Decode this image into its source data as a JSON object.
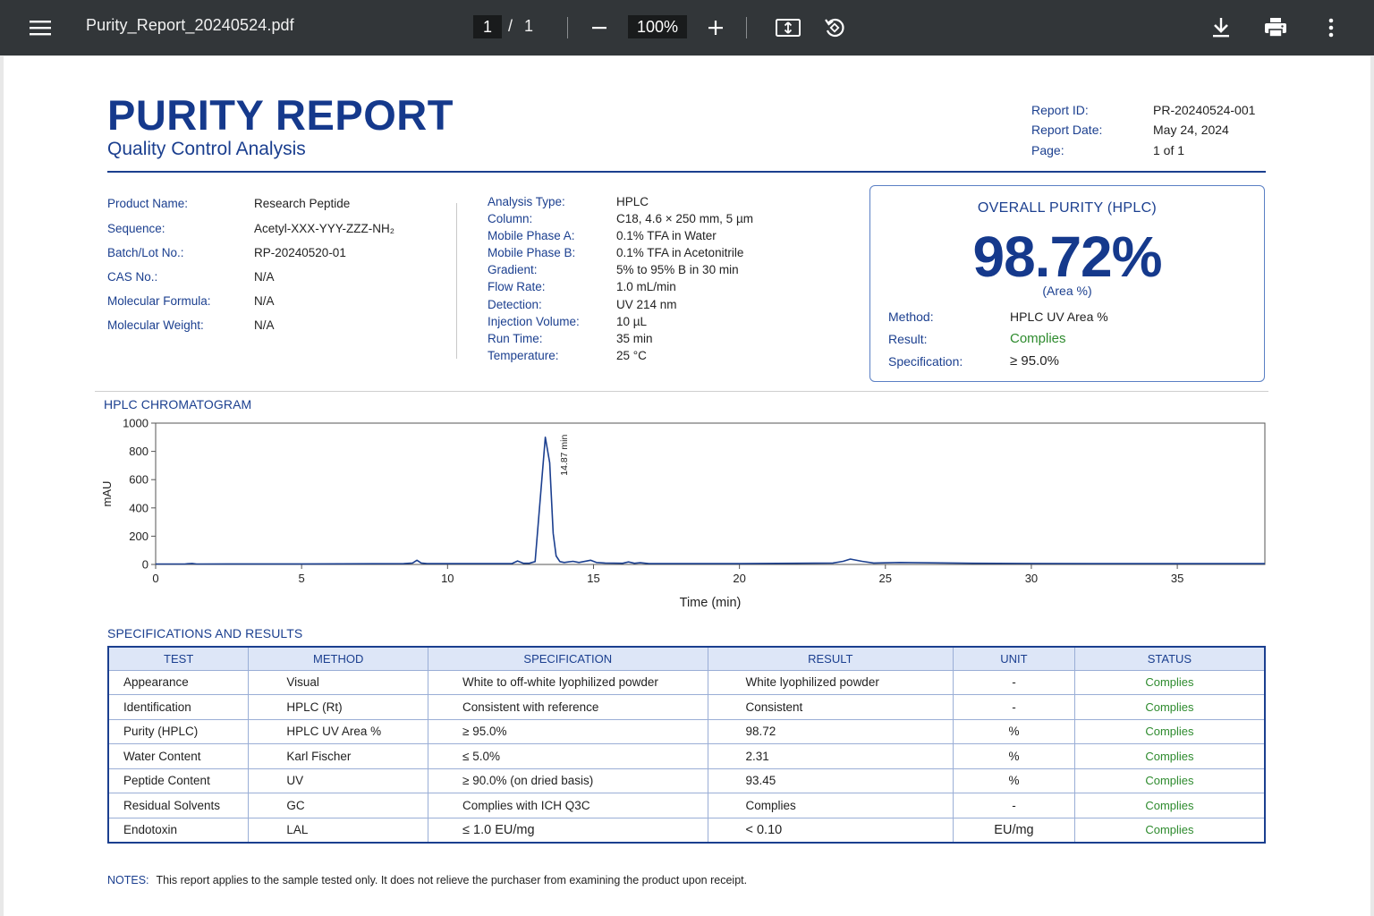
{
  "viewer": {
    "file_name": "Purity_Report_20240524.pdf",
    "current_page": "1",
    "page_separator": "/",
    "total_pages": "1",
    "zoom": "100%",
    "icons": [
      "menu-icon",
      "zoom-out-icon",
      "zoom-in-icon",
      "fit-page-icon",
      "rotate-icon",
      "download-icon",
      "print-icon",
      "more-icon"
    ]
  },
  "report": {
    "title": "PURITY REPORT",
    "subtitle": "Quality Control Analysis",
    "meta": [
      {
        "label": "Report ID:",
        "value": "PR-20240524-001"
      },
      {
        "label": "Report Date:",
        "value": "May 24, 2024"
      },
      {
        "label": "Page:",
        "value": "1 of 1"
      }
    ],
    "product": [
      {
        "label": "Product Name:",
        "value": "Research Peptide"
      },
      {
        "label": "Sequence:",
        "value": "Acetyl-XXX-YYY-ZZZ-NH₂"
      },
      {
        "label": "Batch/Lot No.:",
        "value": "RP-20240520-01"
      },
      {
        "label": "CAS No.:",
        "value": "N/A"
      },
      {
        "label": "Molecular Formula:",
        "value": "N/A"
      },
      {
        "label": "Molecular Weight:",
        "value": "N/A"
      }
    ],
    "analysis": [
      {
        "label": "Analysis Type:",
        "value": "HPLC"
      },
      {
        "label": "Column:",
        "value": "C18, 4.6 × 250 mm, 5 µm"
      },
      {
        "label": "Mobile Phase A:",
        "value": "0.1% TFA in Water"
      },
      {
        "label": "Mobile Phase B:",
        "value": "0.1% TFA in Acetonitrile"
      },
      {
        "label": "Gradient:",
        "value": "5% to 95% B in 30 min"
      },
      {
        "label": "Flow Rate:",
        "value": "1.0 mL/min"
      },
      {
        "label": "Detection:",
        "value": "UV 214 nm"
      },
      {
        "label": "Injection Volume:",
        "value": "10 µL"
      },
      {
        "label": "Run Time:",
        "value": "35 min"
      },
      {
        "label": "Temperature:",
        "value": "25 °C"
      }
    ],
    "purity": {
      "heading": "OVERALL PURITY (HPLC)",
      "value": "98.72%",
      "basis": "(Area %)",
      "rows": [
        {
          "label": "Method:",
          "value": "HPLC UV Area %"
        },
        {
          "label": "Result:",
          "value": "Complies"
        },
        {
          "label": "Specification:",
          "value": "≥ 95.0%"
        }
      ]
    },
    "chromatogram_title": "HPLC CHROMATOGRAM",
    "specs_title": "SPECIFICATIONS AND RESULTS",
    "specs_headers": [
      "TEST",
      "METHOD",
      "SPECIFICATION",
      "RESULT",
      "UNIT",
      "STATUS"
    ],
    "specs_rows": [
      [
        "Appearance",
        "Visual",
        "White to off-white lyophilized powder",
        "White lyophilized powder",
        "-",
        "Complies"
      ],
      [
        "Identification",
        "HPLC (Rt)",
        "Consistent with reference",
        "Consistent",
        "-",
        "Complies"
      ],
      [
        "Purity (HPLC)",
        "HPLC UV Area %",
        "≥ 95.0%",
        "98.72",
        "%",
        "Complies"
      ],
      [
        "Water Content",
        "Karl Fischer",
        "≤ 5.0%",
        "2.31",
        "%",
        "Complies"
      ],
      [
        "Peptide Content",
        "UV",
        "≥ 90.0% (on dried basis)",
        "93.45",
        "%",
        "Complies"
      ],
      [
        "Residual Solvents",
        "GC",
        "Complies with ICH Q3C",
        "Complies",
        "-",
        "Complies"
      ],
      [
        "Endotoxin",
        "LAL",
        "≤ 1.0 EU/mg",
        "< 0.10",
        "EU/mg",
        "Complies"
      ]
    ],
    "notes_label": "NOTES:",
    "notes_text": "This report applies to the sample tested only. It does not relieve the purchaser from examining the product upon receipt."
  },
  "chart_data": {
    "type": "line",
    "title": "",
    "xlabel": "Time (min)",
    "ylabel": "mAU",
    "xlim": [
      0,
      38
    ],
    "ylim": [
      0,
      1000
    ],
    "x_ticks": [
      0,
      5,
      10,
      15,
      20,
      25,
      30,
      35
    ],
    "x_tick_labels": [
      "0",
      "5",
      "10",
      "15",
      "20",
      "25",
      "30",
      "35"
    ],
    "y_ticks": [
      0,
      200,
      400,
      600,
      800,
      1000
    ],
    "y_tick_labels": [
      "0",
      "200",
      "400",
      "600",
      "800",
      "1000"
    ],
    "grid": false,
    "color": "#1b3f8f",
    "annotations": [
      {
        "x": 14.1,
        "y": 920,
        "text": "14.87 min"
      }
    ],
    "series": [
      {
        "x": [
          0,
          1.0,
          1.1,
          1.25,
          1.4,
          5,
          8.5,
          8.8,
          8.95,
          9.1,
          9.3,
          12.2,
          12.4,
          12.6,
          12.8,
          13.0,
          13.35,
          13.5,
          13.62,
          13.72,
          13.85,
          14.0,
          14.3,
          14.5,
          14.9,
          15.1,
          15.4,
          16.0,
          16.2,
          16.4,
          16.6,
          16.9,
          17.2,
          20,
          23.2,
          23.55,
          23.8,
          24.2,
          24.6,
          25.5,
          28,
          32,
          35,
          38
        ],
        "y": [
          3,
          3,
          5,
          7,
          3,
          4,
          6,
          10,
          30,
          10,
          6,
          6,
          25,
          8,
          8,
          20,
          900,
          720,
          220,
          60,
          20,
          14,
          22,
          14,
          30,
          14,
          10,
          8,
          18,
          8,
          12,
          6,
          6,
          6,
          10,
          22,
          38,
          22,
          10,
          14,
          8,
          6,
          6,
          6
        ]
      }
    ]
  }
}
